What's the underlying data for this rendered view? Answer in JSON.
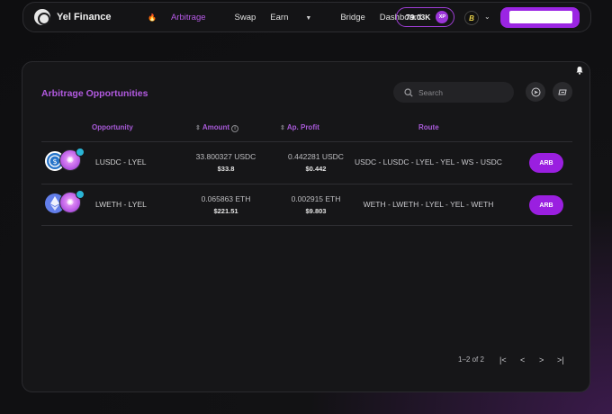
{
  "header": {
    "brand": "Yel Finance",
    "nav": [
      {
        "label": "Arbitrage",
        "active": true
      },
      {
        "label": "Swap"
      },
      {
        "label": "Earn"
      },
      {
        "label": "Bridge"
      },
      {
        "label": "Dashboard"
      }
    ],
    "xp_value": "79.03K",
    "xp_badge": "XP",
    "chain_glyph": "B"
  },
  "panel": {
    "title": "Arbitrage Opportunities",
    "search_placeholder": "Search",
    "columns": {
      "opportunity": "Opportunity",
      "amount": "Amount",
      "profit": "Ap. Profit",
      "route": "Route"
    },
    "rows": [
      {
        "pair": "LUSDC - LYEL",
        "amount": "33.800327 USDC",
        "amount_usd": "$33.8",
        "profit": "0.442281 USDC",
        "profit_usd": "$0.442",
        "route": "USDC - LUSDC - LYEL - YEL - WS - USDC",
        "action": "ARB",
        "token_color": "#2775ca"
      },
      {
        "pair": "LWETH - LYEL",
        "amount": "0.065863 ETH",
        "amount_usd": "$221.51",
        "profit": "0.002915 ETH",
        "profit_usd": "$9.803",
        "route": "WETH - LWETH - LYEL - YEL - WETH",
        "action": "ARB",
        "token_color": "#627eea"
      }
    ],
    "pagination": "1–2 of 2"
  },
  "colors": {
    "accent": "#9b25e3",
    "title": "#b25ae0"
  }
}
